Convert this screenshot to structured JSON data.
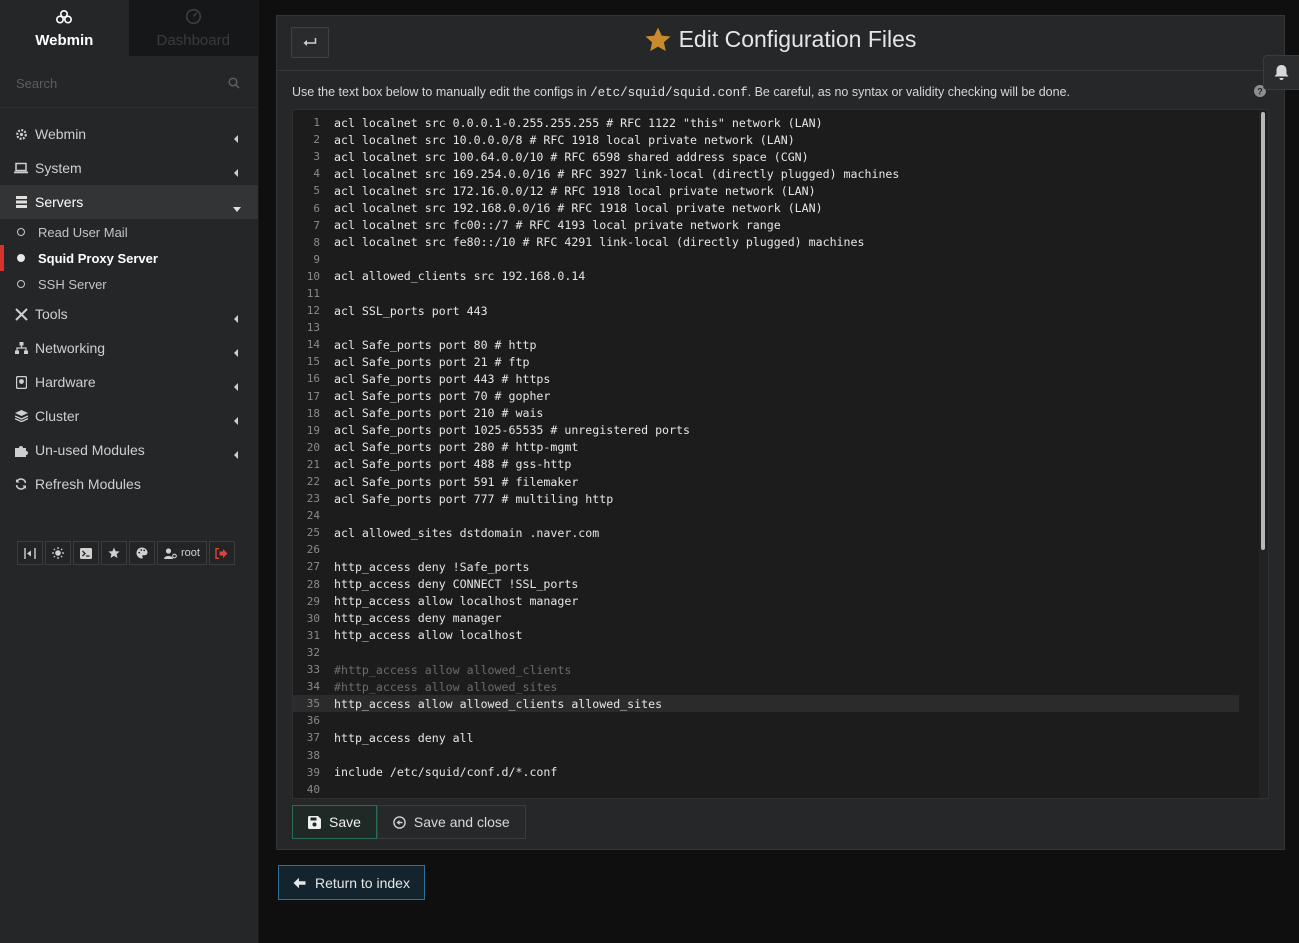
{
  "sidebar": {
    "tabs": [
      {
        "label": "Webmin",
        "icon": "webmin-logo-icon"
      },
      {
        "label": "Dashboard",
        "icon": "dashboard-icon"
      }
    ],
    "search_placeholder": "Search",
    "menu": [
      {
        "label": "Webmin",
        "icon": "gear-icon"
      },
      {
        "label": "System",
        "icon": "laptop-icon"
      },
      {
        "label": "Servers",
        "icon": "server-icon"
      },
      {
        "label": "Tools",
        "icon": "tools-icon"
      },
      {
        "label": "Networking",
        "icon": "network-icon"
      },
      {
        "label": "Hardware",
        "icon": "hdd-icon"
      },
      {
        "label": "Cluster",
        "icon": "layers-icon"
      },
      {
        "label": "Un-used Modules",
        "icon": "puzzle-icon"
      },
      {
        "label": "Refresh Modules",
        "icon": "refresh-icon"
      }
    ],
    "servers_submenu": [
      {
        "label": "Read User Mail"
      },
      {
        "label": "Squid Proxy Server"
      },
      {
        "label": "SSH Server"
      }
    ],
    "toolbar": {
      "user_label": "root"
    }
  },
  "panel": {
    "title": "Edit Configuration Files",
    "description_prefix": "Use the text box below to manually edit the configs in ",
    "config_path": "/etc/squid/squid.conf",
    "description_suffix": ". Be careful, as no syntax or validity checking will be done."
  },
  "editor": {
    "lines": [
      {
        "n": "1",
        "text": "acl localnet src 0.0.0.1-0.255.255.255 # RFC 1122 \"this\" network (LAN)"
      },
      {
        "n": "2",
        "text": "acl localnet src 10.0.0.0/8 # RFC 1918 local private network (LAN)"
      },
      {
        "n": "3",
        "text": "acl localnet src 100.64.0.0/10 # RFC 6598 shared address space (CGN)"
      },
      {
        "n": "4",
        "text": "acl localnet src 169.254.0.0/16 # RFC 3927 link-local (directly plugged) machines"
      },
      {
        "n": "5",
        "text": "acl localnet src 172.16.0.0/12 # RFC 1918 local private network (LAN)"
      },
      {
        "n": "6",
        "text": "acl localnet src 192.168.0.0/16 # RFC 1918 local private network (LAN)"
      },
      {
        "n": "7",
        "text": "acl localnet src fc00::/7 # RFC 4193 local private network range"
      },
      {
        "n": "8",
        "text": "acl localnet src fe80::/10 # RFC 4291 link-local (directly plugged) machines"
      },
      {
        "n": "9",
        "text": ""
      },
      {
        "n": "10",
        "text": "acl allowed_clients src 192.168.0.14"
      },
      {
        "n": "11",
        "text": ""
      },
      {
        "n": "12",
        "text": "acl SSL_ports port 443"
      },
      {
        "n": "13",
        "text": ""
      },
      {
        "n": "14",
        "text": "acl Safe_ports port 80 # http"
      },
      {
        "n": "15",
        "text": "acl Safe_ports port 21 # ftp"
      },
      {
        "n": "16",
        "text": "acl Safe_ports port 443 # https"
      },
      {
        "n": "17",
        "text": "acl Safe_ports port 70 # gopher"
      },
      {
        "n": "18",
        "text": "acl Safe_ports port 210 # wais"
      },
      {
        "n": "19",
        "text": "acl Safe_ports port 1025-65535 # unregistered ports"
      },
      {
        "n": "20",
        "text": "acl Safe_ports port 280 # http-mgmt"
      },
      {
        "n": "21",
        "text": "acl Safe_ports port 488 # gss-http"
      },
      {
        "n": "22",
        "text": "acl Safe_ports port 591 # filemaker"
      },
      {
        "n": "23",
        "text": "acl Safe_ports port 777 # multiling http"
      },
      {
        "n": "24",
        "text": ""
      },
      {
        "n": "25",
        "text": "acl allowed_sites dstdomain .naver.com"
      },
      {
        "n": "26",
        "text": ""
      },
      {
        "n": "27",
        "text": "http_access deny !Safe_ports"
      },
      {
        "n": "28",
        "text": "http_access deny CONNECT !SSL_ports"
      },
      {
        "n": "29",
        "text": "http_access allow localhost manager"
      },
      {
        "n": "30",
        "text": "http_access deny manager"
      },
      {
        "n": "31",
        "text": "http_access allow localhost"
      },
      {
        "n": "32",
        "text": ""
      },
      {
        "n": "33",
        "text": "#http_access allow allowed_clients"
      },
      {
        "n": "34",
        "text": "#http_access allow allowed_sites"
      },
      {
        "n": "35",
        "text": "http_access allow allowed_clients allowed_sites"
      },
      {
        "n": "36",
        "text": ""
      },
      {
        "n": "37",
        "text": "http_access deny all"
      },
      {
        "n": "38",
        "text": ""
      },
      {
        "n": "39",
        "text": "include /etc/squid/conf.d/*.conf"
      },
      {
        "n": "40",
        "text": ""
      }
    ],
    "highlighted_line": "35",
    "scroll_fraction_visible": 0.64
  },
  "buttons": {
    "save": "Save",
    "save_close": "Save and close",
    "return": "Return to index"
  },
  "colors": {
    "accent_red": "#d9312c",
    "star": "#c78a2c",
    "save_border": "#2c6b55",
    "return_border": "#2f6f9a"
  }
}
